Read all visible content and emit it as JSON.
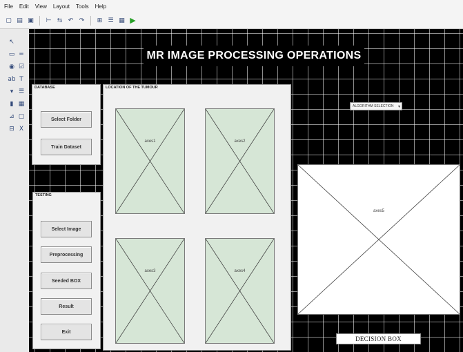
{
  "menu": [
    "File",
    "Edit",
    "View",
    "Layout",
    "Tools",
    "Help"
  ],
  "toolbar": {
    "icons": [
      "new-icon",
      "open-icon",
      "save-icon",
      "align-icon",
      "tab-order-icon",
      "menu-editor-icon",
      "toolbar-editor-icon",
      "property-inspector-icon",
      "object-browser-icon",
      "editor-icon",
      "run-icon"
    ],
    "glyphs": [
      "▢",
      "▤",
      "▣",
      "⊢",
      "⇆",
      "↶",
      "↷",
      "⊞",
      "☰",
      "▦",
      "▶"
    ]
  },
  "palette": {
    "items": [
      "select-tool-icon",
      "pushbutton-tool-icon",
      "slider-tool-icon",
      "radio-tool-icon",
      "checkbox-tool-icon",
      "edit-text-tool-icon",
      "static-text-tool-icon",
      "popup-tool-icon",
      "listbox-tool-icon",
      "toggle-tool-icon",
      "table-tool-icon",
      "axes-tool-icon",
      "panel-tool-icon",
      "buttongroup-tool-icon",
      "activex-tool-icon"
    ],
    "glyphs": [
      "↖",
      "▭",
      "═",
      "◉",
      "☑",
      "ab",
      "T",
      "▾",
      "☰",
      "▮",
      "▦",
      "⊿",
      "▢",
      "⊟",
      "X"
    ]
  },
  "title": "MR IMAGE PROCESSING OPERATIONS",
  "database_panel": {
    "title": "DATABASE",
    "buttons": [
      "Select Folder",
      "Train Dataset"
    ]
  },
  "testing_panel": {
    "title": "TESTING",
    "buttons": [
      "Select Image",
      "Preprocessing",
      "Seeded BOX",
      "Result",
      "Exit"
    ]
  },
  "location_panel": {
    "title": "LOCATION OF THE TUMOUR",
    "axes": [
      "axes1",
      "axes2",
      "axes3",
      "axes4"
    ]
  },
  "popup": {
    "value": "ALGORITHM SELECTION"
  },
  "big_axes": {
    "label": "axes5"
  },
  "decision_box": "DECISION BOX"
}
